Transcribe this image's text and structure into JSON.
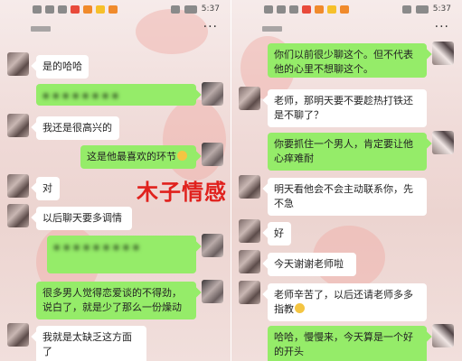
{
  "status_bar": {
    "time": "5:37"
  },
  "watermark": "木子情感",
  "left_chat": {
    "messages": [
      {
        "side": "left",
        "text": "是的哈哈"
      },
      {
        "side": "right",
        "text": "▪ ▪ ▪ ▪ ▪ ▪ ▪ ▪"
      },
      {
        "side": "left",
        "text": "我还是很高兴的"
      },
      {
        "side": "right",
        "text": "这是他最喜欢的环节"
      },
      {
        "side": "left",
        "text": "对"
      },
      {
        "side": "left",
        "text": "以后聊天要多调情"
      },
      {
        "side": "right",
        "text": "▪ ▪ ▪ ▪ ▪ ▪ ▪ ▪ ▪"
      },
      {
        "side": "right",
        "text": "很多男人觉得恋爱谈的不得劲，说白了，就是少了那么一份燥动"
      },
      {
        "side": "left",
        "text": "我就是太缺乏这方面了"
      }
    ]
  },
  "right_chat": {
    "messages": [
      {
        "side": "right",
        "text": "你们以前很少聊这个。但不代表他的心里不想聊这个。"
      },
      {
        "side": "left",
        "text": "老师，那明天要不要趁热打铁还是不聊了？"
      },
      {
        "side": "right",
        "text": "你要抓住一个男人，肯定要让他心痒难耐"
      },
      {
        "side": "left",
        "text": "明天看他会不会主动联系你，先不急"
      },
      {
        "side": "right",
        "text": "好"
      },
      {
        "side": "left",
        "text": "今天谢谢老师啦"
      },
      {
        "side": "left",
        "text": "老师辛苦了，以后还请老师多多指教"
      },
      {
        "side": "right",
        "text": "哈哈，慢慢来，今天算是一个好的开头"
      }
    ]
  }
}
